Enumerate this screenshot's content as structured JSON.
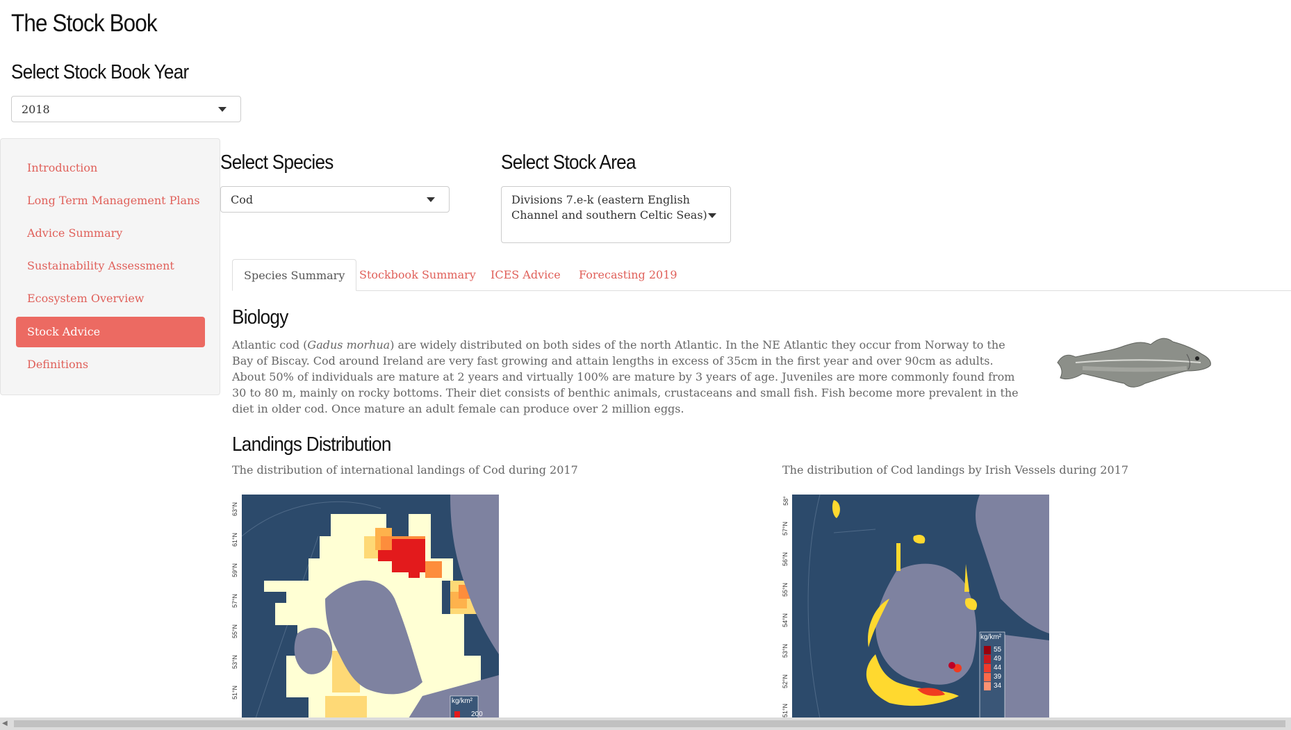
{
  "app": {
    "title": "The Stock Book"
  },
  "year_select": {
    "heading": "Select Stock Book Year",
    "value": "2018"
  },
  "sidebar": {
    "items": [
      {
        "label": "Introduction",
        "active": false
      },
      {
        "label": "Long Term Management Plans",
        "active": false
      },
      {
        "label": "Advice Summary",
        "active": false
      },
      {
        "label": "Sustainability Assessment",
        "active": false
      },
      {
        "label": "Ecosystem Overview",
        "active": false
      },
      {
        "label": "Stock Advice",
        "active": true
      },
      {
        "label": "Definitions",
        "active": false
      }
    ]
  },
  "species_select": {
    "heading": "Select Species",
    "value": "Cod"
  },
  "area_select": {
    "heading": "Select Stock Area",
    "value": "Divisions 7.e-k (eastern English Channel and southern Celtic Seas)"
  },
  "tabs": [
    {
      "label": "Species Summary",
      "active": true
    },
    {
      "label": "Stockbook Summary",
      "active": false
    },
    {
      "label": "ICES Advice",
      "active": false
    },
    {
      "label": "Forecasting 2019",
      "active": false
    }
  ],
  "biology": {
    "heading": "Biology",
    "pre": "Atlantic cod (",
    "latin": "Gadus morhua",
    "post": ") are widely distributed on both sides of the north Atlantic. In the NE Atlantic they occur from Norway to the Bay of Biscay. Cod around Ireland are very fast growing and attain lengths in excess of 35cm in the first year and over 90cm as adults. About 50% of individuals are mature at 2 years and virtually 100% are mature by 3 years of age. Juveniles are more commonly found from 30 to 80 m, mainly on rocky bottoms. Their diet consists of benthic animals, crustaceans and small fish. Fish become more prevalent in the diet in older cod. Once mature an adult female can produce over 2 million eggs."
  },
  "landings": {
    "heading": "Landings Distribution",
    "caption_international": "The distribution of international landings of Cod during 2017",
    "caption_irish": "The distribution of Cod landings by Irish Vessels during 2017",
    "map1": {
      "lat_labels": [
        "63°N",
        "61°N",
        "59°N",
        "57°N",
        "55°N",
        "53°N",
        "51°N"
      ],
      "legend_title": "kg/km²",
      "legend_values": [
        "200"
      ]
    },
    "map2": {
      "lat_labels": [
        "58°",
        "57°N",
        "56°N",
        "55°N",
        "54°N",
        "53°N",
        "52°N",
        "51°N"
      ],
      "legend_title": "kg/km²",
      "legend_values": [
        "55",
        "49",
        "44",
        "39",
        "34"
      ]
    }
  },
  "colors": {
    "accent": "#e0605a",
    "active_nav": "#ec6a62",
    "sea": "#2c4a6b",
    "land": "#7e82a0",
    "heat_low": "#ffffd4",
    "heat_high": "#e31a1c"
  }
}
